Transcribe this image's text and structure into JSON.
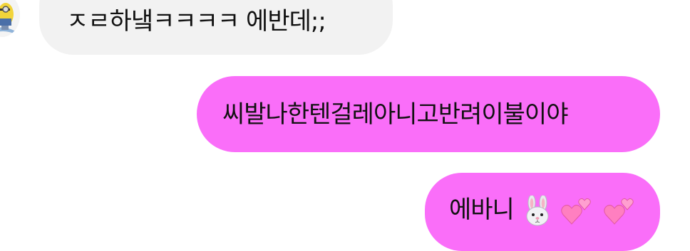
{
  "colors": {
    "received_bubble": "#f2f2f2",
    "sent_bubble": "#fa6ef9",
    "text": "#111111"
  },
  "messages": [
    {
      "direction": "received",
      "text": "ㅈㄹ하냌ㅋㅋㅋㅋ 에반데;;"
    },
    {
      "direction": "sent",
      "text": "씨발나한텐걸레아니고반려이불이야"
    },
    {
      "direction": "sent",
      "text": "에바니",
      "emojis": [
        "rabbit-face",
        "two-hearts",
        "two-hearts"
      ]
    }
  ]
}
